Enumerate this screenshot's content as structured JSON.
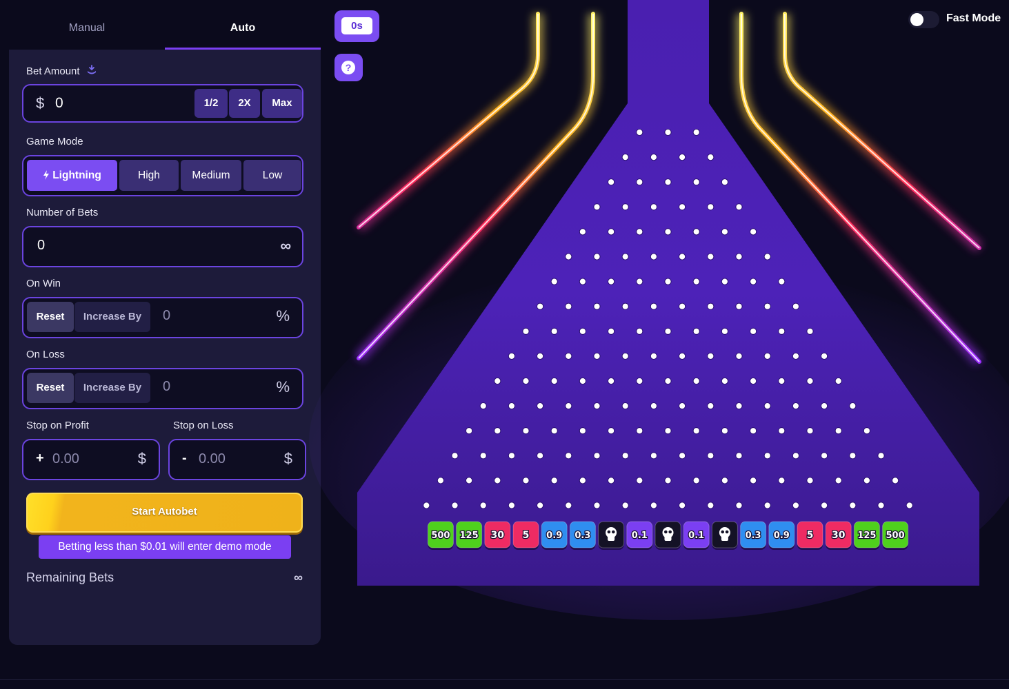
{
  "tabs": {
    "manual": "Manual",
    "auto": "Auto"
  },
  "bet": {
    "label": "Bet Amount",
    "currency_symbol": "$",
    "value": "0",
    "half_label": "1/2",
    "double_label": "2X",
    "max_label": "Max"
  },
  "game_mode": {
    "label": "Game Mode",
    "options": [
      "Lightning",
      "High",
      "Medium",
      "Low"
    ],
    "selected": "Lightning"
  },
  "number_of_bets": {
    "label": "Number of Bets",
    "value": "0",
    "infinity_symbol": "∞"
  },
  "on_win": {
    "label": "On Win",
    "reset_label": "Reset",
    "increase_label": "Increase By",
    "value": "0",
    "unit": "%"
  },
  "on_loss": {
    "label": "On Loss",
    "reset_label": "Reset",
    "increase_label": "Increase By",
    "value": "0",
    "unit": "%"
  },
  "stop_on_profit": {
    "label": "Stop on Profit",
    "sign": "+",
    "value": "0.00",
    "currency_symbol": "$"
  },
  "stop_on_loss": {
    "label": "Stop on Loss",
    "sign": "-",
    "value": "0.00",
    "currency_symbol": "$"
  },
  "start_button": "Start Autobet",
  "demo_notice": "Betting less than $0.01 will enter demo mode",
  "remaining": {
    "label": "Remaining Bets",
    "value": "∞"
  },
  "timer": "0s",
  "help_icon": "?",
  "fast_mode": {
    "label": "Fast Mode",
    "enabled": false
  },
  "board": {
    "rows": 16,
    "multipliers": [
      "500",
      "125",
      "30",
      "5",
      "0.9",
      "0.3",
      "skull",
      "0.1",
      "skull",
      "0.1",
      "skull",
      "0.3",
      "0.9",
      "5",
      "30",
      "125",
      "500"
    ],
    "colors": {
      "green": "#4fd11d",
      "red": "#ef2b63",
      "blue": "#2f8ef0",
      "purple": "#7b3ff2",
      "dark": "#141226",
      "accent": "#7b4df2"
    }
  }
}
